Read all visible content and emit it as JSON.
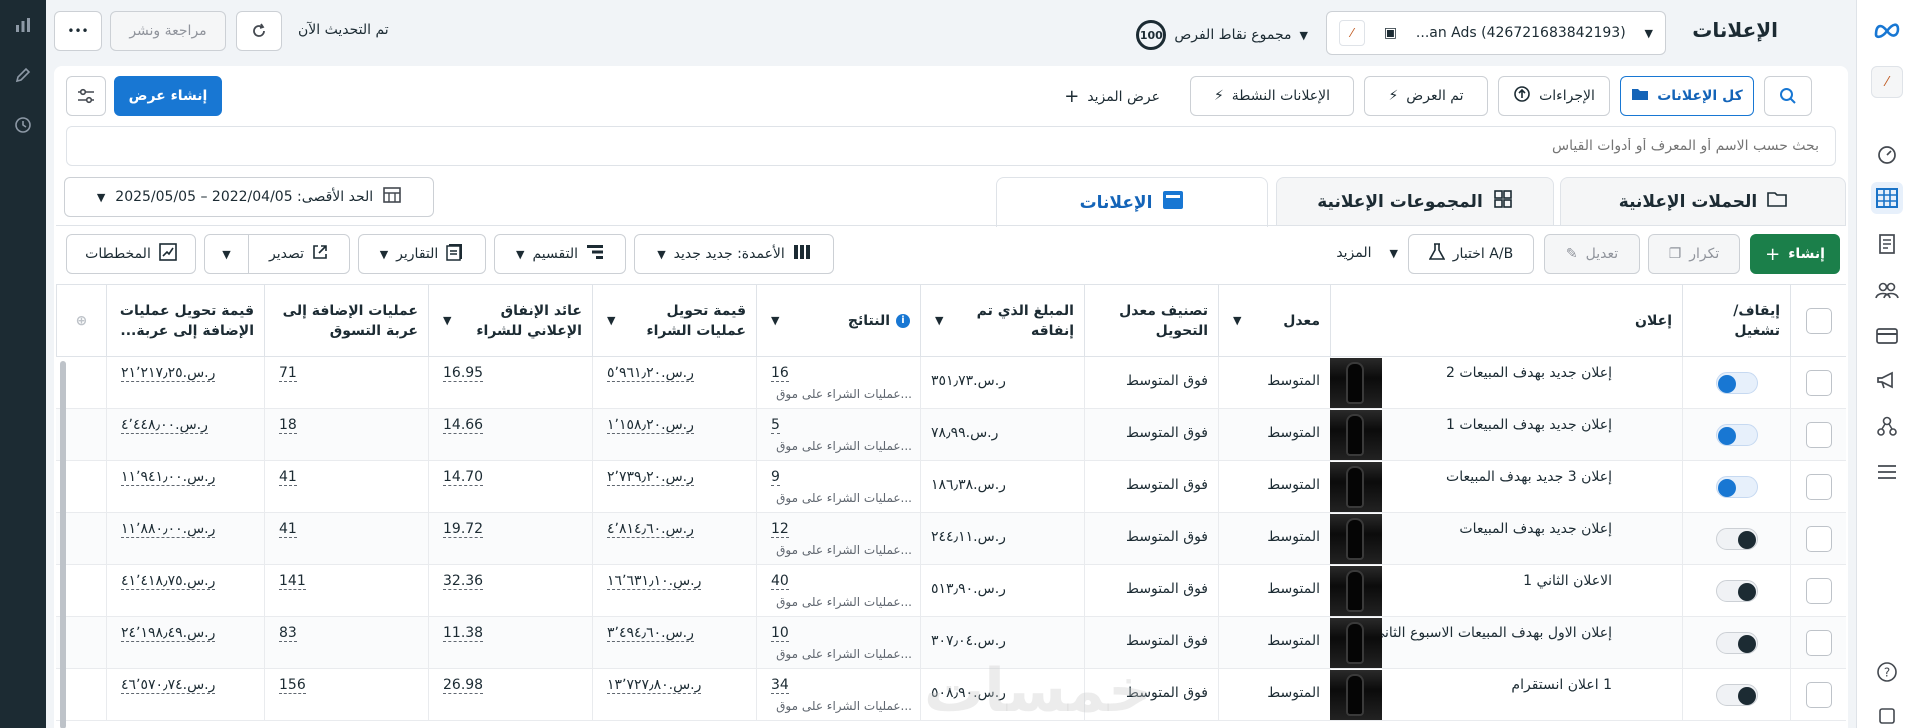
{
  "header": {
    "title": "الإعلانات",
    "account_name": "...an Ads (426721683842193)",
    "opportunity_score": "100",
    "opportunity_label": "مجموع نقاط الفرص",
    "updated_text": "تم التحديث الآن",
    "review_publish_label": "مراجعة ونشر",
    "more_label": "•••"
  },
  "toolbar": {
    "all_ads_label": "كل الإعلانات",
    "actions_label": "الإجراءات",
    "viewed_label": "تم العرض",
    "active_ads_label": "الإعلانات النشطة",
    "show_more_label": "عرض المزيد",
    "create_view_label": "إنشاء عرض"
  },
  "search": {
    "placeholder": "بحث حسب الاسم أو المعرف أو أدوات القياس"
  },
  "date_range": {
    "label": "الحد الأقصى: 2022/04/05 – 2025/05/05"
  },
  "tabs": [
    {
      "label": "الحملات الإعلانية"
    },
    {
      "label": "المجموعات الإعلانية"
    },
    {
      "label": "الإعلانات"
    }
  ],
  "actions": {
    "create_label": "إنشاء",
    "duplicate_label": "تكرار",
    "edit_label": "تعديل",
    "ab_test_label": "اختبار A/B",
    "more_label": "المزيد",
    "columns_label": "الأعمدة: جديد جديد",
    "breakdown_label": "التقسيم",
    "reports_label": "التقارير",
    "export_label": "تصدير",
    "charts_label": "المخططات"
  },
  "columns": {
    "toggle": "إيقاف/ تشغيل",
    "ad": "إعلان",
    "rate": "معدل",
    "conv_rank": "تصنيف معدل التحويل",
    "spent": "المبلغ الذي تم إنفاقه",
    "results": "النتائج",
    "purchase_value": "قيمة تحويل عمليات الشراء",
    "roas": "عائد الإنفاق الإعلاني للشراء",
    "add_to_cart": "عمليات الإضافة إلى عربة التسوق",
    "add_to_cart_value": "قيمة تحويل عمليات الإضافة إلى عربة..."
  },
  "rows": [
    {
      "name": "إعلان جديد بهدف المبيعات 2",
      "on": true,
      "rate": "المتوسط",
      "rank": "فوق المتوسط",
      "spent": "ر.س.٣٥١٫٧٣",
      "results": "16",
      "results_sub": "عمليات الشراء على موق...",
      "purchase_value": "ر.س.٥٬٩٦١٫٢٠",
      "roas": "16.95",
      "atc": "71",
      "atc_value": "ر.س.٢١٬٢١٧٫٢٥"
    },
    {
      "name": "إعلان جديد بهدف المبيعات 1",
      "on": true,
      "rate": "المتوسط",
      "rank": "فوق المتوسط",
      "spent": "ر.س.٧٨٫٩٩",
      "results": "5",
      "results_sub": "عمليات الشراء على موق...",
      "purchase_value": "ر.س.١٬١٥٨٫٢٠",
      "roas": "14.66",
      "atc": "18",
      "atc_value": "ر.س.٤٬٤٤٨٫٠٠"
    },
    {
      "name": "إعلان 3 جديد بهدف المبيعات",
      "on": true,
      "rate": "المتوسط",
      "rank": "فوق المتوسط",
      "spent": "ر.س.١٨٦٫٣٨",
      "results": "9",
      "results_sub": "عمليات الشراء على موق...",
      "purchase_value": "ر.س.٢٬٧٣٩٫٢٠",
      "roas": "14.70",
      "atc": "41",
      "atc_value": "ر.س.١١٬٩٤١٫٠٠"
    },
    {
      "name": "إعلان جديد بهدف المبيعات",
      "on": false,
      "rate": "المتوسط",
      "rank": "فوق المتوسط",
      "spent": "ر.س.٢٤٤٫١١",
      "results": "12",
      "results_sub": "عمليات الشراء على موق...",
      "purchase_value": "ر.س.٤٬٨١٤٫٦٠",
      "roas": "19.72",
      "atc": "41",
      "atc_value": "ر.س.١١٬٨٨٠٫٠٠"
    },
    {
      "name": "الاعلان الثاني 1",
      "on": false,
      "rate": "المتوسط",
      "rank": "فوق المتوسط",
      "spent": "ر.س.٥١٣٫٩٠",
      "results": "40",
      "results_sub": "عمليات الشراء على موق...",
      "purchase_value": "ر.س.١٦٬٦٣١٫١٠",
      "roas": "32.36",
      "atc": "141",
      "atc_value": "ر.س.٤١٬٤١٨٫٧٥"
    },
    {
      "name": "إعلان الاول بهدف المبيعات الاسبوع الثاني",
      "on": false,
      "rate": "المتوسط",
      "rank": "فوق المتوسط",
      "spent": "ر.س.٣٠٧٫٠٤",
      "results": "10",
      "results_sub": "عمليات الشراء على موق...",
      "purchase_value": "ر.س.٣٬٤٩٤٫٦٠",
      "roas": "11.38",
      "atc": "83",
      "atc_value": "ر.س.٢٤٬١٩٨٫٤٩"
    },
    {
      "name": "1 اعلان انستقرام",
      "on": false,
      "rate": "المتوسط",
      "rank": "فوق المتوسط",
      "spent": "ر.س.٥٠٨٫٩٠",
      "results": "34",
      "results_sub": "عمليات الشراء على موق...",
      "purchase_value": "ر.س.١٣٬٧٢٧٫٨٠",
      "roas": "26.98",
      "atc": "156",
      "atc_value": "ر.س.٤٦٬٥٧٠٫٧٤"
    }
  ],
  "watermark": "خمسات",
  "colors": {
    "primary": "#1877d3",
    "create": "#1b7f4a",
    "sidebar": "#1c2b33"
  }
}
